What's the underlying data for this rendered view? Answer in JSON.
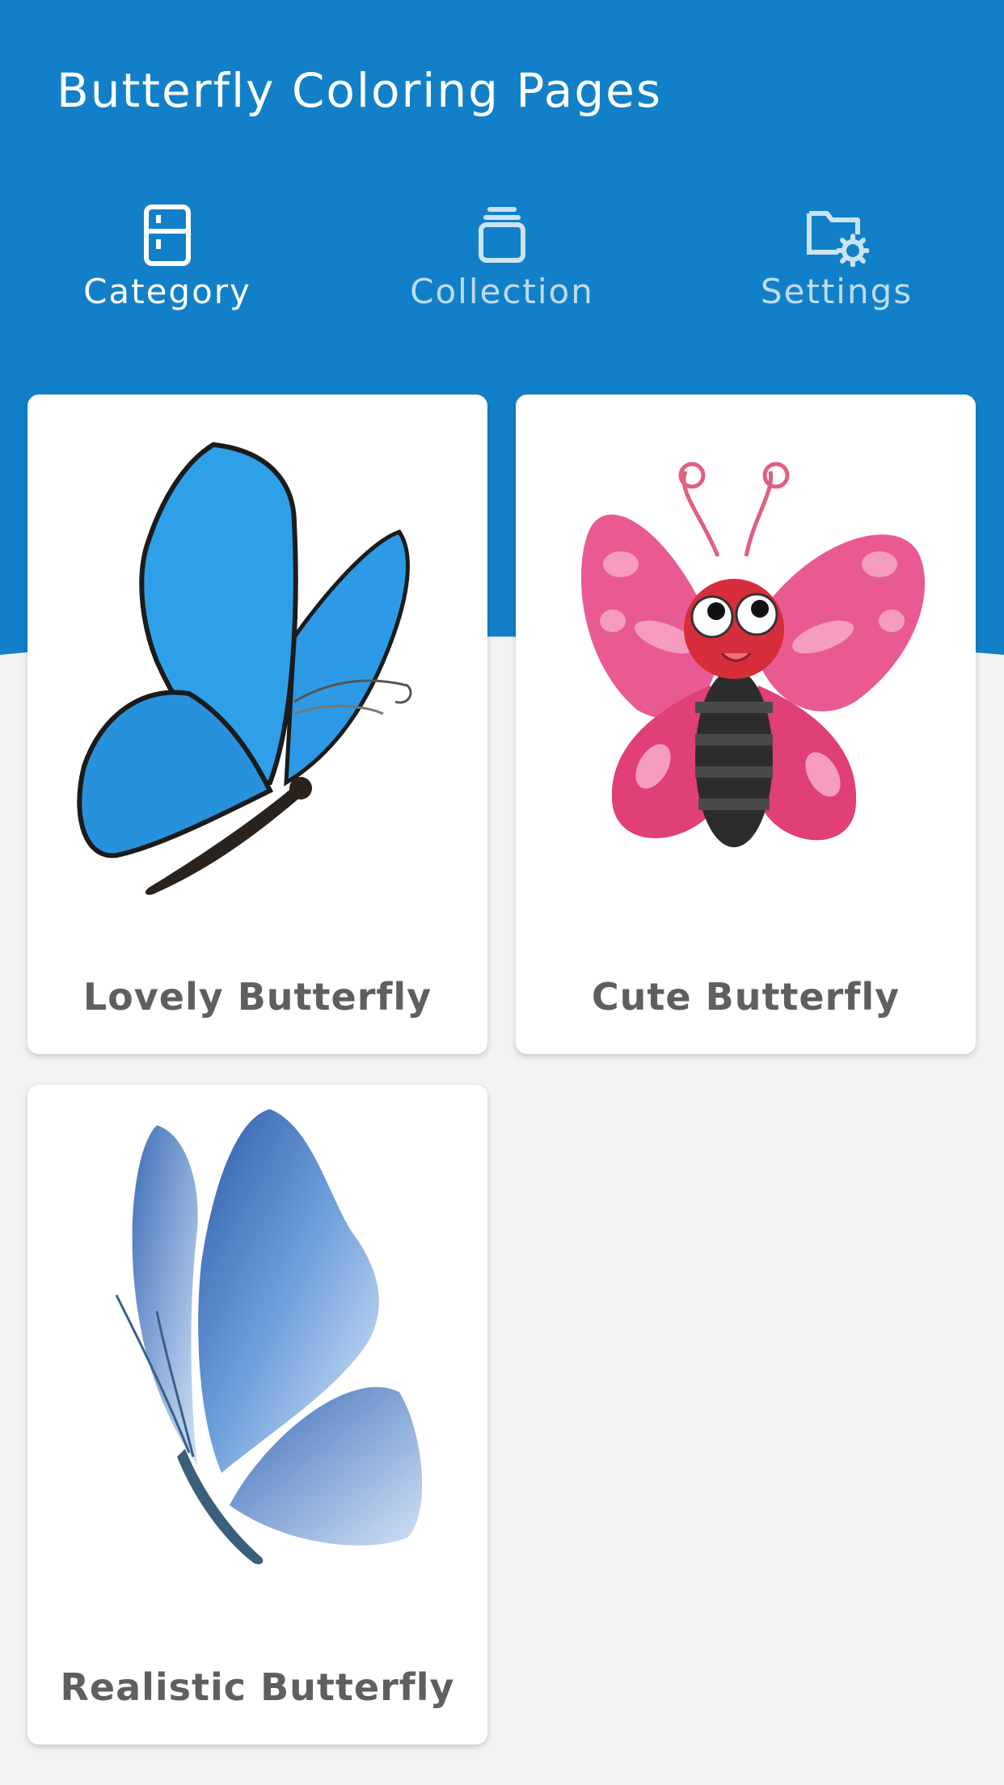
{
  "app": {
    "title": "Butterfly Coloring Pages",
    "primary_color": "#1280c8",
    "background_color": "#f3f3f3"
  },
  "tabs": [
    {
      "label": "Category",
      "icon": "cabinet-icon",
      "active": true
    },
    {
      "label": "Collection",
      "icon": "stack-icon",
      "active": false
    },
    {
      "label": "Settings",
      "icon": "folder-gear-icon",
      "active": false
    }
  ],
  "categories": [
    {
      "label": "Lovely Butterfly",
      "image": "blue-cartoon-butterfly"
    },
    {
      "label": "Cute Butterfly",
      "image": "pink-cute-butterfly"
    },
    {
      "label": "Realistic Butterfly",
      "image": "watercolor-blue-butterfly"
    }
  ]
}
